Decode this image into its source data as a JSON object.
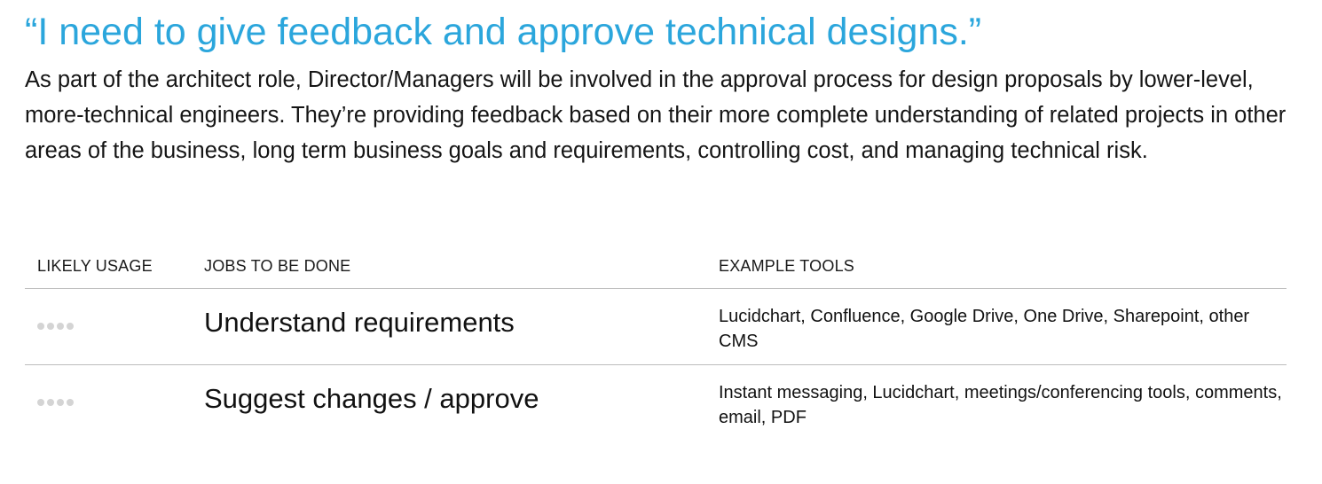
{
  "title": "“I need to give feedback and approve technical designs.”",
  "description": "As part of the architect role, Director/Managers will be involved in the approval process for design proposals by lower-level, more-technical engineers. They’re providing feedback based on their more complete understanding of related projects in other areas of the business, long term business goals and requirements, controlling cost, and managing technical risk.",
  "table": {
    "headers": {
      "usage": "LIKELY USAGE",
      "jobs": "JOBS TO BE DONE",
      "tools": "EXAMPLE TOOLS"
    },
    "rows": [
      {
        "job": "Understand requirements",
        "tools": "Lucidchart, Confluence, Google Drive, One Drive, Sharepoint, other CMS",
        "usage_level": 0
      },
      {
        "job": "Suggest changes / approve",
        "tools": "Instant messaging, Lucidchart, meetings/conferencing tools, comments, email, PDF",
        "usage_level": 0
      }
    ]
  },
  "colors": {
    "title": "#2ba6dc",
    "divider": "#bdbdbd",
    "inactive_dot": "#d4d4d4"
  }
}
